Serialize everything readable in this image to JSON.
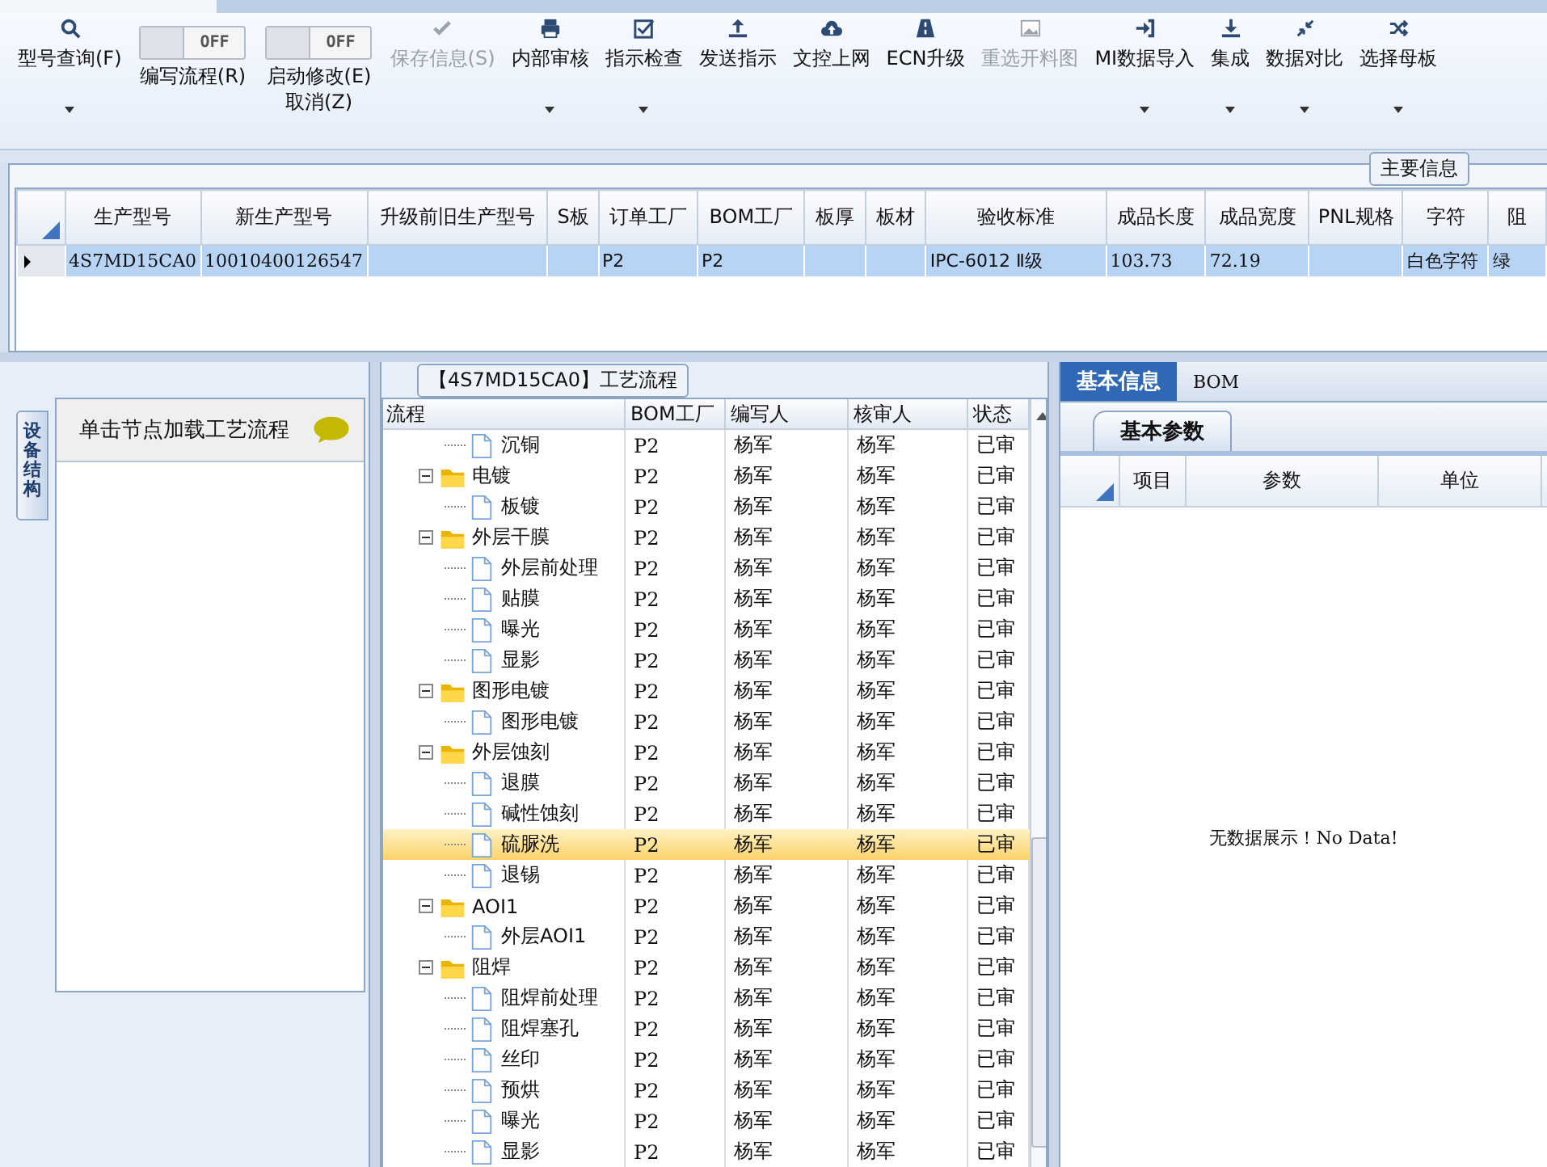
{
  "toolbar": [
    {
      "kind": "button",
      "label": "型号查询(F)",
      "disabled": false,
      "dropdown": true
    },
    {
      "kind": "toggle",
      "label": "编写流程(R)",
      "state_text": "OFF",
      "on": false
    },
    {
      "kind": "toggle",
      "label": "启动修改(E)",
      "label_2": "取消(Z)",
      "state_text": "OFF",
      "on": false
    },
    {
      "kind": "button",
      "label": "保存信息(S)",
      "disabled": true,
      "dropdown": false
    },
    {
      "kind": "button",
      "label": "内部审核",
      "disabled": false,
      "dropdown": true
    },
    {
      "kind": "button",
      "label": "指示检查",
      "disabled": false,
      "dropdown": true
    },
    {
      "kind": "button",
      "label": "发送指示",
      "disabled": false,
      "dropdown": false
    },
    {
      "kind": "button",
      "label": "文控上网",
      "disabled": false,
      "dropdown": false
    },
    {
      "kind": "button",
      "label": "ECN升级",
      "disabled": false,
      "dropdown": false
    },
    {
      "kind": "button",
      "label": "重选开料图",
      "disabled": true,
      "dropdown": false
    },
    {
      "kind": "button",
      "label": "MI数据导入",
      "disabled": false,
      "dropdown": true
    },
    {
      "kind": "button",
      "label": "集成",
      "disabled": false,
      "dropdown": true
    },
    {
      "kind": "button",
      "label": "数据对比",
      "disabled": false,
      "dropdown": true
    },
    {
      "kind": "button",
      "label": "选择母板",
      "disabled": false,
      "dropdown": true
    }
  ],
  "main_info": {
    "title": "主要信息",
    "table": {
      "columns": [
        "生产型号",
        "新生产型号",
        "升级前旧生产型号",
        "S板",
        "订单工厂",
        "BOM工厂",
        "板厚",
        "板材",
        "验收标准",
        "成品长度",
        "成品宽度",
        "PNL规格",
        "字符",
        "阻"
      ],
      "rows": [
        {
          "selected": true,
          "cells": [
            "4S7MD15CA0",
            "10010400126547",
            "",
            "",
            "P2",
            "P2",
            "",
            "",
            "IPC-6012 Ⅱ级",
            "103.73",
            "72.19",
            "",
            "白色字符",
            "绿"
          ]
        }
      ]
    }
  },
  "side_panel": {
    "tab": "设备结构",
    "hint": "单击节点加载工艺流程"
  },
  "process": {
    "title": "【4S7MD15CA0】工艺流程",
    "columns": [
      "流程",
      "BOM工厂",
      "编写人",
      "核审人",
      "状态"
    ],
    "nodes": [
      {
        "kind": "step",
        "name": "沉铜",
        "factory": "P2",
        "writer": "杨军",
        "reviewer": "杨军",
        "status": "已审",
        "selected": false
      },
      {
        "kind": "group",
        "name": "电镀",
        "factory": "P2",
        "writer": "杨军",
        "reviewer": "杨军",
        "status": "已审",
        "expanded": true,
        "children": [
          {
            "kind": "step",
            "name": "板镀",
            "factory": "P2",
            "writer": "杨军",
            "reviewer": "杨军",
            "status": "已审",
            "selected": false
          }
        ]
      },
      {
        "kind": "group",
        "name": "外层干膜",
        "factory": "P2",
        "writer": "杨军",
        "reviewer": "杨军",
        "status": "已审",
        "expanded": true,
        "children": [
          {
            "kind": "step",
            "name": "外层前处理",
            "factory": "P2",
            "writer": "杨军",
            "reviewer": "杨军",
            "status": "已审",
            "selected": false
          },
          {
            "kind": "step",
            "name": "贴膜",
            "factory": "P2",
            "writer": "杨军",
            "reviewer": "杨军",
            "status": "已审",
            "selected": false
          },
          {
            "kind": "step",
            "name": "曝光",
            "factory": "P2",
            "writer": "杨军",
            "reviewer": "杨军",
            "status": "已审",
            "selected": false
          },
          {
            "kind": "step",
            "name": "显影",
            "factory": "P2",
            "writer": "杨军",
            "reviewer": "杨军",
            "status": "已审",
            "selected": false
          }
        ]
      },
      {
        "kind": "group",
        "name": "图形电镀",
        "factory": "P2",
        "writer": "杨军",
        "reviewer": "杨军",
        "status": "已审",
        "expanded": true,
        "children": [
          {
            "kind": "step",
            "name": "图形电镀",
            "factory": "P2",
            "writer": "杨军",
            "reviewer": "杨军",
            "status": "已审",
            "selected": false
          }
        ]
      },
      {
        "kind": "group",
        "name": "外层蚀刻",
        "factory": "P2",
        "writer": "杨军",
        "reviewer": "杨军",
        "status": "已审",
        "expanded": true,
        "children": [
          {
            "kind": "step",
            "name": "退膜",
            "factory": "P2",
            "writer": "杨军",
            "reviewer": "杨军",
            "status": "已审",
            "selected": false
          },
          {
            "kind": "step",
            "name": "碱性蚀刻",
            "factory": "P2",
            "writer": "杨军",
            "reviewer": "杨军",
            "status": "已审",
            "selected": false
          },
          {
            "kind": "step",
            "name": "硫脲洗",
            "factory": "P2",
            "writer": "杨军",
            "reviewer": "杨军",
            "status": "已审",
            "selected": true
          },
          {
            "kind": "step",
            "name": "退锡",
            "factory": "P2",
            "writer": "杨军",
            "reviewer": "杨军",
            "status": "已审",
            "selected": false
          }
        ]
      },
      {
        "kind": "group",
        "name": "AOI1",
        "factory": "P2",
        "writer": "杨军",
        "reviewer": "杨军",
        "status": "已审",
        "expanded": true,
        "children": [
          {
            "kind": "step",
            "name": "外层AOI1",
            "factory": "P2",
            "writer": "杨军",
            "reviewer": "杨军",
            "status": "已审",
            "selected": false
          }
        ]
      },
      {
        "kind": "group",
        "name": "阻焊",
        "factory": "P2",
        "writer": "杨军",
        "reviewer": "杨军",
        "status": "已审",
        "expanded": true,
        "children": [
          {
            "kind": "step",
            "name": "阻焊前处理",
            "factory": "P2",
            "writer": "杨军",
            "reviewer": "杨军",
            "status": "已审",
            "selected": false
          },
          {
            "kind": "step",
            "name": "阻焊塞孔",
            "factory": "P2",
            "writer": "杨军",
            "reviewer": "杨军",
            "status": "已审",
            "selected": false
          },
          {
            "kind": "step",
            "name": "丝印",
            "factory": "P2",
            "writer": "杨军",
            "reviewer": "杨军",
            "status": "已审",
            "selected": false
          },
          {
            "kind": "step",
            "name": "预烘",
            "factory": "P2",
            "writer": "杨军",
            "reviewer": "杨军",
            "status": "已审",
            "selected": false
          },
          {
            "kind": "step",
            "name": "曝光",
            "factory": "P2",
            "writer": "杨军",
            "reviewer": "杨军",
            "status": "已审",
            "selected": false
          },
          {
            "kind": "step",
            "name": "显影",
            "factory": "P2",
            "writer": "杨军",
            "reviewer": "杨军",
            "status": "已审",
            "selected": false
          }
        ]
      }
    ]
  },
  "details": {
    "tabs": [
      {
        "label": "基本信息",
        "selected": true
      },
      {
        "label": "BOM",
        "selected": false
      }
    ],
    "subtabs": [
      {
        "label": "基本参数",
        "selected": true
      }
    ],
    "columns": [
      "项目",
      "参数",
      "单位"
    ],
    "empty_text": "无数据展示！No Data!"
  }
}
